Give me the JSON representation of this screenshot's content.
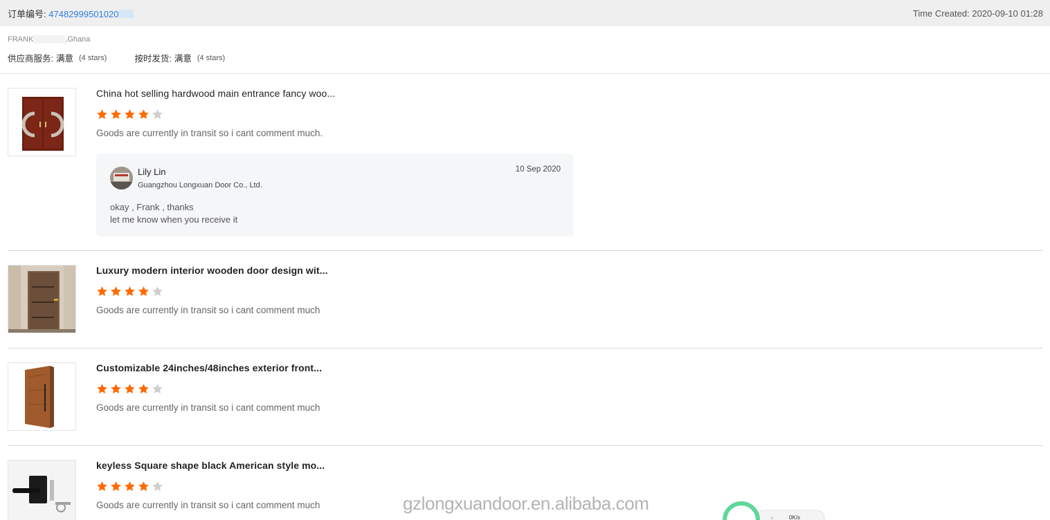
{
  "order": {
    "label": "订单编号:",
    "number": "47482999501020",
    "time_created": "Time Created: 2020-09-10 01:28"
  },
  "buyer": {
    "name_prefix": "FRANK",
    "country": ",Ghana"
  },
  "ratings": {
    "supplier_service_label": "供应商服务:",
    "supplier_service_value": "满意",
    "supplier_service_stars": "(4 stars)",
    "ontime_delivery_label": "按时发货:",
    "ontime_delivery_value": "满意",
    "ontime_delivery_stars": "(4 stars)"
  },
  "reviews": [
    {
      "title": "China hot selling hardwood main entrance fancy woo...",
      "rating": 4,
      "comment": "Goods are currently in transit so i cant comment much.",
      "reply": {
        "name": "Lily Lin",
        "company": "Guangzhou Longxuan Door Co., Ltd.",
        "date": "10 Sep 2020",
        "message_line1": "okay ,  Frank , thanks",
        "message_line2": "let me know when you receive it"
      }
    },
    {
      "title": "Luxury modern interior wooden door design wit...",
      "rating": 4,
      "comment": "Goods are currently in transit so i cant comment much"
    },
    {
      "title": "Customizable 24inches/48inches exterior front...",
      "rating": 4,
      "comment": "Goods are currently in transit so i cant comment much"
    },
    {
      "title": "keyless Square shape black American style mo...",
      "rating": 4,
      "comment": "Goods are currently in transit so i cant comment much"
    }
  ],
  "watermark": "gzlongxuandoor.en.alibaba.com",
  "net_widget": {
    "speed": "0K/s"
  },
  "colors": {
    "star_filled": "#ff6a00",
    "star_empty": "#cfcfcf",
    "link_blue": "#2b7de0"
  }
}
